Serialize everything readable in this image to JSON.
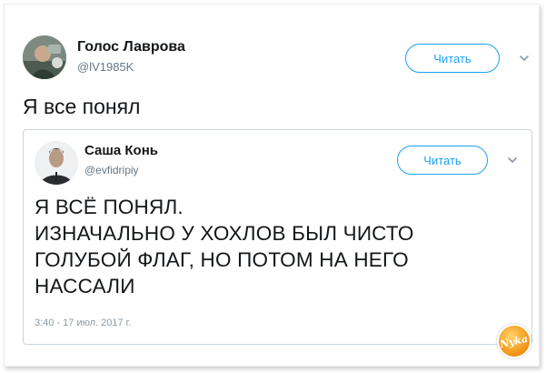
{
  "outer_tweet": {
    "author_name": "Голос Лаврова",
    "author_handle": "@lV1985K",
    "follow_label": "Читать",
    "text": "Я все понял"
  },
  "quoted_tweet": {
    "author_name": "Саша Конь",
    "author_handle": "@evfidripiy",
    "follow_label": "Читать",
    "text_lines": [
      "Я ВСЁ ПОНЯЛ.",
      "ИЗНАЧАЛЬНО У ХОХЛОВ БЫЛ ЧИСТО",
      "ГОЛУБОЙ ФЛАГ, НО ПОТОМ НА НЕГО",
      "НАССАЛИ"
    ],
    "timestamp": "3:40 - 17 июл. 2017 г."
  },
  "watermark": {
    "text": "Nyka"
  },
  "colors": {
    "accent": "#1da1f2",
    "secondary_text": "#657786",
    "border": "#ccd6dd"
  }
}
